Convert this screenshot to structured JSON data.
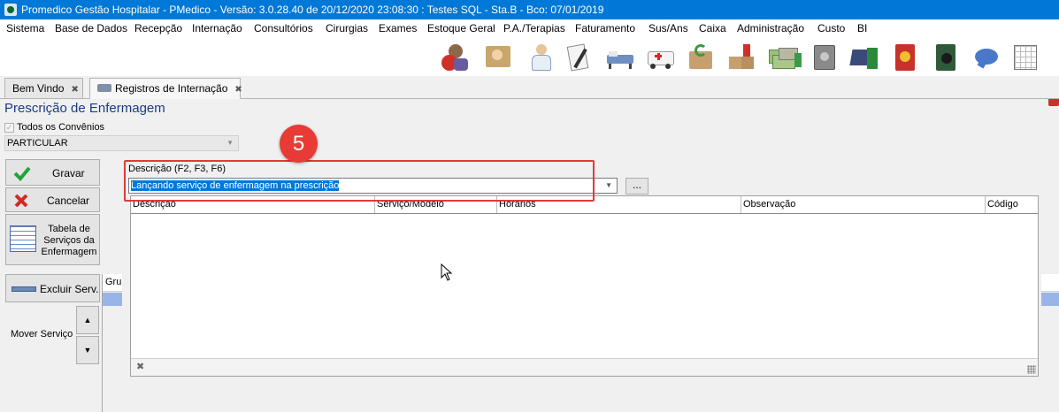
{
  "window": {
    "title": "Promedico Gestão Hospitalar - PMedico - Versão: 3.0.28.40 de 20/12/2020 23:08:30 : Testes SQL - Sta.B - Bco: 07/01/2019"
  },
  "menu": [
    "Sistema",
    "Base de Dados",
    "Recepção",
    "Internação",
    "Consultórios",
    "Cirurgias",
    "Exames",
    "Estoque Geral",
    "P.A./Terapias",
    "Faturamento",
    "Sus/Ans",
    "Caixa",
    "Administração",
    "Custo",
    "BI"
  ],
  "toolbar_icons": [
    "refresh-user-icon",
    "reception-icon",
    "doctor-icon",
    "prescription-icon",
    "hospital-bed-icon",
    "ambulance-icon",
    "recycle-box-icon",
    "stock-boxes-icon",
    "money-icon",
    "money-down-icon",
    "safe-icon",
    "card-reader-icon",
    "phone-book-icon",
    "book-disc-icon",
    "chat-bubble-icon",
    "spreadsheet-icon"
  ],
  "tabs": [
    {
      "label": "Bem Vindo",
      "active": false
    },
    {
      "label": "Registros de Internação",
      "active": true
    }
  ],
  "page": {
    "title": "Prescrição de Enfermagem",
    "all_convenios_label": "Todos os Convênios",
    "all_convenios_checked": true,
    "convenio_value": "PARTICULAR"
  },
  "buttons": {
    "save": "Gravar",
    "cancel": "Cancelar",
    "table_line1": "Tabela de",
    "table_line2": "Serviços da",
    "table_line3": "Enfermagem",
    "delete_service": "Excluir Serv.",
    "move_service": "Mover Serviço",
    "ellipsis": "..."
  },
  "description": {
    "label": "Descrição (F2, F3, F6)",
    "value": "Lançando serviço de enfermagem na prescrição"
  },
  "grid": {
    "columns": [
      "Descrição",
      "Serviço/Modelo",
      "Horarios",
      "Observação",
      "Código"
    ],
    "rows": []
  },
  "background_grid": {
    "column": "Grupo"
  },
  "hidden_letter": "C",
  "annotation": {
    "step": "5"
  },
  "colors": {
    "titlebar": "#0078d7",
    "accent_red": "#e03a3a",
    "selection": "#0078d7",
    "title_text": "#1b3a86"
  }
}
